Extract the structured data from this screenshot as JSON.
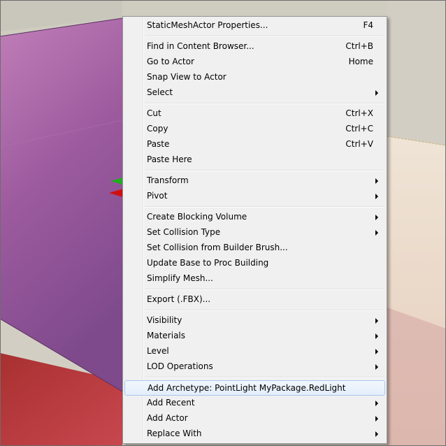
{
  "menu": {
    "groups": [
      [
        {
          "label": "StaticMeshActor Properties...",
          "shortcut": "F4",
          "submenu": false
        }
      ],
      [
        {
          "label": "Find in Content Browser...",
          "shortcut": "Ctrl+B",
          "submenu": false
        },
        {
          "label": "Go to Actor",
          "shortcut": "Home",
          "submenu": false
        },
        {
          "label": "Snap View to Actor",
          "shortcut": "",
          "submenu": false
        },
        {
          "label": "Select",
          "shortcut": "",
          "submenu": true
        }
      ],
      [
        {
          "label": "Cut",
          "shortcut": "Ctrl+X",
          "submenu": false
        },
        {
          "label": "Copy",
          "shortcut": "Ctrl+C",
          "submenu": false
        },
        {
          "label": "Paste",
          "shortcut": "Ctrl+V",
          "submenu": false
        },
        {
          "label": "Paste Here",
          "shortcut": "",
          "submenu": false
        }
      ],
      [
        {
          "label": "Transform",
          "shortcut": "",
          "submenu": true
        },
        {
          "label": "Pivot",
          "shortcut": "",
          "submenu": true
        }
      ],
      [
        {
          "label": "Create Blocking Volume",
          "shortcut": "",
          "submenu": true
        },
        {
          "label": "Set Collision Type",
          "shortcut": "",
          "submenu": true
        },
        {
          "label": "Set Collision from Builder Brush...",
          "shortcut": "",
          "submenu": false
        },
        {
          "label": "Update Base to Proc Building",
          "shortcut": "",
          "submenu": false
        },
        {
          "label": "Simplify Mesh...",
          "shortcut": "",
          "submenu": false
        }
      ],
      [
        {
          "label": "Export (.FBX)...",
          "shortcut": "",
          "submenu": false
        }
      ],
      [
        {
          "label": "Visibility",
          "shortcut": "",
          "submenu": true
        },
        {
          "label": "Materials",
          "shortcut": "",
          "submenu": true
        },
        {
          "label": "Level",
          "shortcut": "",
          "submenu": true
        },
        {
          "label": "LOD Operations",
          "shortcut": "",
          "submenu": true
        }
      ],
      [
        {
          "label": "Add Archetype: PointLight MyPackage.RedLight",
          "shortcut": "",
          "submenu": false,
          "highlighted": true
        },
        {
          "label": "Add Recent",
          "shortcut": "",
          "submenu": true
        },
        {
          "label": "Add Actor",
          "shortcut": "",
          "submenu": true
        },
        {
          "label": "Replace With",
          "shortcut": "",
          "submenu": true
        }
      ]
    ]
  },
  "colors": {
    "mesh_purple": "#9a5a9a",
    "floor_red": "#b23a40",
    "wall_cream": "#ecd9c8",
    "highlight_border": "#a8c8ec",
    "gizmo_green": "#1fae1f",
    "gizmo_red": "#d01010"
  }
}
